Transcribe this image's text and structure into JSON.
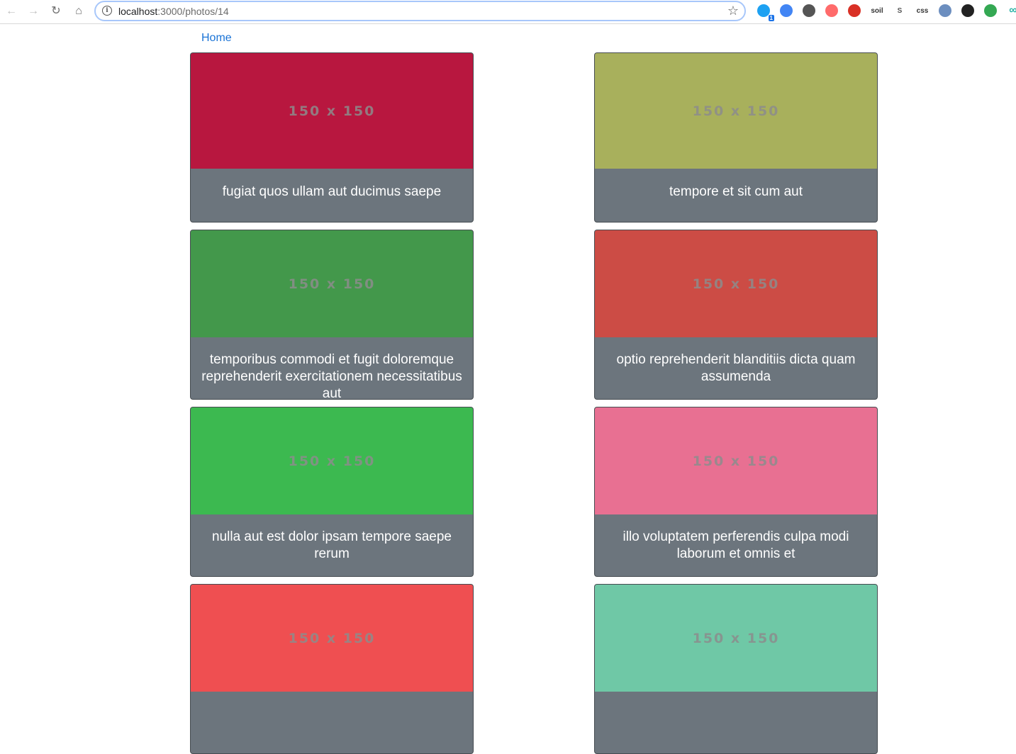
{
  "browser": {
    "url_host": "localhost",
    "url_path": ":3000/photos/14",
    "extensions": [
      {
        "icon": "twitter-bird-icon",
        "color": "#1da1f2",
        "badge": "1"
      },
      {
        "icon": "google-translate-icon",
        "color": "#4285f4",
        "badge": ""
      },
      {
        "icon": "chat-bubble-icon",
        "color": "#555555",
        "badge": ""
      },
      {
        "icon": "record-icon",
        "color": "#ff6b6b",
        "badge": ""
      },
      {
        "icon": "red-tool-icon",
        "color": "#d93025",
        "badge": ""
      },
      {
        "icon": "soil-icon",
        "color": "#333333",
        "badge": ""
      },
      {
        "icon": "s-letter-icon",
        "color": "#555555",
        "badge": ""
      },
      {
        "icon": "css-icon",
        "color": "#333333",
        "badge": ""
      },
      {
        "icon": "circle-slash-icon",
        "color": "#6c8ebf",
        "badge": ""
      },
      {
        "icon": "refresh-dark-icon",
        "color": "#222222",
        "badge": ""
      },
      {
        "icon": "shield-check-icon",
        "color": "#34a853",
        "badge": ""
      },
      {
        "icon": "infinity-icon",
        "color": "#2ab3a6",
        "badge": ""
      }
    ],
    "ext_labels": [
      "",
      "",
      "",
      "",
      "",
      "soil",
      "S",
      "css",
      "",
      "",
      "",
      "∞"
    ]
  },
  "page": {
    "home_label": "Home"
  },
  "photos": [
    {
      "image_text": "150 x 150",
      "bg": "#b8173f",
      "title": "fugiat quos ullam aut ducimus saepe"
    },
    {
      "image_text": "150 x 150",
      "bg": "#a8b05c",
      "title": "tempore et sit cum aut"
    },
    {
      "image_text": "150 x 150",
      "bg": "#43984b",
      "title": "temporibus commodi et fugit doloremque reprehenderit exercitationem necessitatibus aut"
    },
    {
      "image_text": "150 x 150",
      "bg": "#cc4c45",
      "title": "optio reprehenderit blanditiis dicta quam assumenda"
    },
    {
      "image_text": "150 x 150",
      "bg": "#3cb950",
      "title": "nulla aut est dolor ipsam tempore saepe rerum"
    },
    {
      "image_text": "150 x 150",
      "bg": "#e87092",
      "title": "illo voluptatem perferendis culpa modi laborum et omnis et"
    },
    {
      "image_text": "150 x 150",
      "bg": "#ef4f51",
      "title": ""
    },
    {
      "image_text": "150 x 150",
      "bg": "#6fc8a6",
      "title": ""
    }
  ]
}
